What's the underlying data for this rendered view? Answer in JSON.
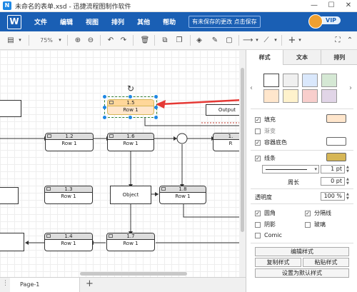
{
  "window": {
    "title": "未命名的表单.xsd - 迅捷流程图制作软件",
    "minimize": "—",
    "maximize": "☐",
    "close": "✕"
  },
  "menubar": {
    "logo": "W",
    "items": [
      "文件",
      "编辑",
      "视图",
      "排列",
      "其他",
      "帮助"
    ],
    "unsaved_notice": "有未保存的更改 点击保存",
    "vip_label": "VIP"
  },
  "toolbar": {
    "zoom": "75%"
  },
  "canvas": {
    "nodes": [
      {
        "id": "1.5",
        "label": "1.5",
        "row": "Row 1"
      },
      {
        "id": "1.2",
        "label": "1.2",
        "row": "Row 1"
      },
      {
        "id": "1.6",
        "label": "1.6",
        "row": "Row 1"
      },
      {
        "id": "1.3",
        "label": "1.3",
        "row": "Row 1"
      },
      {
        "id": "1.8",
        "label": "1.8",
        "row": "Row 1"
      },
      {
        "id": "1.4",
        "label": "1.4",
        "row": "Row 1"
      },
      {
        "id": "1.7",
        "label": "1.7",
        "row": "Row 1"
      },
      {
        "id": "r1",
        "label": "1.",
        "row": "R"
      }
    ],
    "object_label": "Object",
    "output_label": "Output"
  },
  "pagebar": {
    "page_name": "Page-1",
    "add_page": "+",
    "menu_dots": "⋮"
  },
  "panel": {
    "tabs": [
      "样式",
      "文本",
      "排列"
    ],
    "active_tab": "样式",
    "swatch_colors": [
      "#ffffff",
      "#f0f0f0",
      "#dae8fc",
      "#d5e8d4",
      "#ffe6cc",
      "#fff2cc",
      "#f8cecc",
      "#e1d5e7"
    ],
    "fill_label": "填充",
    "fill_color": "#ffe6cc",
    "gradient_label": "渐变",
    "container_bg_label": "容器底色",
    "container_bg_color": "#ffffff",
    "line_label": "线条",
    "line_color": "#d6b656",
    "line_width": "1 pt",
    "perimeter_label": "周长",
    "perimeter_value": "0 pt",
    "opacity_label": "透明度",
    "opacity_value": "100 %",
    "rounded_label": "圆角",
    "divider_label": "分隔线",
    "shadow_label": "阴影",
    "glass_label": "玻璃",
    "comic_label": "Comic",
    "edit_style_button": "编辑样式",
    "copy_style_button": "复制样式",
    "paste_style_button": "粘贴样式",
    "set_default_button": "设置为默认样式"
  }
}
